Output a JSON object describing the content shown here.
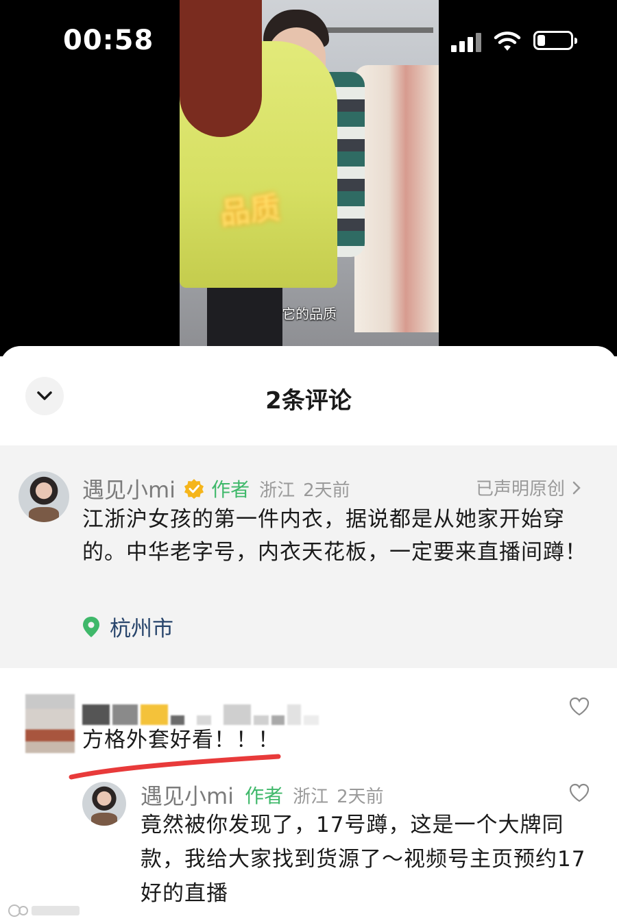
{
  "status": {
    "time": "00:58"
  },
  "video": {
    "subtitle": "它的品质"
  },
  "sheet": {
    "title": "2条评论"
  },
  "pinned_comment": {
    "author": "遇见小mi",
    "author_tag": "作者",
    "region": "浙江",
    "time_ago": "2天前",
    "original_label": "已声明原创",
    "text": "江浙沪女孩的第一件内衣，据说都是从她家开始穿的。中华老字号，内衣天花板，一定要来直播间蹲！",
    "location": "杭州市"
  },
  "comment": {
    "text": "方格外套好看！！！"
  },
  "reply": {
    "author": "遇见小mi",
    "author_tag": "作者",
    "region": "浙江",
    "time_ago": "2天前",
    "text": "竟然被你发现了，17号蹲，这是一个大牌同款，我给大家找到货源了～视频号主页预约17好的直播"
  },
  "colors": {
    "author_green": "#3fb86a",
    "location_blue": "#27446b",
    "underline_red": "#e83a3a",
    "badge_gold": "#f5b51b"
  },
  "icons": [
    "chevron-down-icon",
    "verified-badge-icon",
    "chevron-right-icon",
    "location-pin-icon",
    "heart-icon",
    "wifi-icon",
    "battery-icon"
  ]
}
